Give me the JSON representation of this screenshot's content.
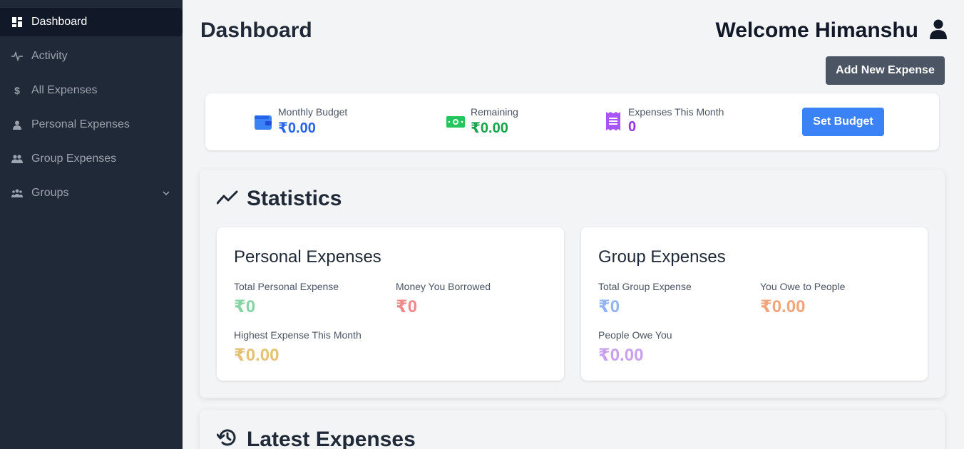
{
  "sidebar": {
    "items": [
      {
        "label": "Dashboard",
        "icon": "dashboard-icon"
      },
      {
        "label": "Activity",
        "icon": "activity-icon"
      },
      {
        "label": "All Expenses",
        "icon": "dollar-icon"
      },
      {
        "label": "Personal Expenses",
        "icon": "user-icon"
      },
      {
        "label": "Group Expenses",
        "icon": "users-icon"
      },
      {
        "label": "Groups",
        "icon": "group-icon"
      }
    ]
  },
  "header": {
    "title": "Dashboard",
    "welcome": "Welcome Himanshu",
    "add_button": "Add New Expense"
  },
  "budget": {
    "monthly_label": "Monthly Budget",
    "monthly_value": "₹0.00",
    "remaining_label": "Remaining",
    "remaining_value": "₹0.00",
    "expenses_label": "Expenses This Month",
    "expenses_value": "0",
    "set_button": "Set Budget"
  },
  "statistics": {
    "title": "Statistics",
    "personal": {
      "title": "Personal Expenses",
      "total_label": "Total Personal Expense",
      "total_value": "₹0",
      "borrowed_label": "Money You Borrowed",
      "borrowed_value": "₹0",
      "highest_label": "Highest Expense This Month",
      "highest_value": "₹0.00"
    },
    "group": {
      "title": "Group Expenses",
      "total_label": "Total Group Expense",
      "total_value": "₹0",
      "owe_label": "You Owe to People",
      "owe_value": "₹0.00",
      "owed_label": "People Owe You",
      "owed_value": "₹0.00"
    }
  },
  "latest": {
    "title": "Latest Expenses"
  },
  "colors": {
    "sidebar_bg": "#1f2937",
    "active_bg": "#111827",
    "primary": "#3b82f6",
    "green": "#16a34a",
    "purple": "#9333ea"
  }
}
